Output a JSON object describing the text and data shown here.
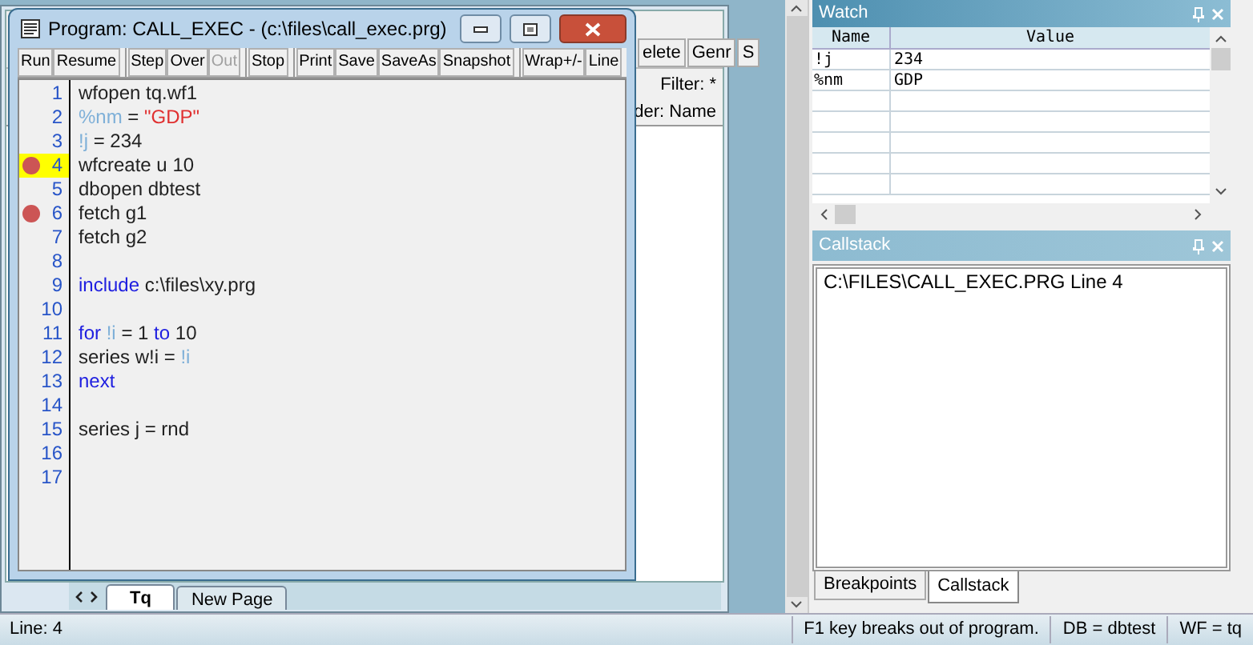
{
  "workfile": {
    "toolbar": [
      "elete",
      "Genr",
      "S"
    ],
    "filter": "Filter: *",
    "order": "der: Name",
    "tabs": [
      {
        "label": "Tq",
        "selected": true
      },
      {
        "label": "New Page",
        "selected": false
      }
    ]
  },
  "program_window": {
    "title": "Program: CALL_EXEC - (c:\\files\\call_exec.prg)",
    "toolbar_groups": [
      [
        {
          "label": "Run",
          "disabled": false
        },
        {
          "label": "Resume",
          "disabled": false
        }
      ],
      [
        {
          "label": "Step",
          "disabled": false
        },
        {
          "label": "Over",
          "disabled": false
        },
        {
          "label": "Out",
          "disabled": true
        }
      ],
      [
        {
          "label": "Stop",
          "disabled": false
        }
      ],
      [
        {
          "label": "Print",
          "disabled": false
        },
        {
          "label": "Save",
          "disabled": false
        },
        {
          "label": "SaveAs",
          "disabled": false
        },
        {
          "label": "Snapshot",
          "disabled": false
        }
      ],
      [
        {
          "label": "Wrap+/-",
          "disabled": false
        },
        {
          "label": "Line",
          "disabled": false
        }
      ]
    ],
    "lines": [
      {
        "number": "1",
        "breakpoint": false,
        "current": false,
        "tokens": [
          {
            "kind": "plain",
            "text": "wfopen tq.wf1"
          }
        ]
      },
      {
        "number": "2",
        "breakpoint": false,
        "current": false,
        "tokens": [
          {
            "kind": "variable",
            "text": "%nm"
          },
          {
            "kind": "plain",
            "text": " = "
          },
          {
            "kind": "string",
            "text": "\"GDP\""
          }
        ]
      },
      {
        "number": "3",
        "breakpoint": false,
        "current": false,
        "tokens": [
          {
            "kind": "variable",
            "text": "!j"
          },
          {
            "kind": "plain",
            "text": " = 234"
          }
        ]
      },
      {
        "number": "4",
        "breakpoint": true,
        "current": true,
        "tokens": [
          {
            "kind": "plain",
            "text": "wfcreate u 10"
          }
        ]
      },
      {
        "number": "5",
        "breakpoint": false,
        "current": false,
        "tokens": [
          {
            "kind": "plain",
            "text": "dbopen dbtest"
          }
        ]
      },
      {
        "number": "6",
        "breakpoint": true,
        "current": false,
        "tokens": [
          {
            "kind": "plain",
            "text": "fetch g1"
          }
        ]
      },
      {
        "number": "7",
        "breakpoint": false,
        "current": false,
        "tokens": [
          {
            "kind": "plain",
            "text": "fetch g2"
          }
        ]
      },
      {
        "number": "8",
        "breakpoint": false,
        "current": false
      },
      {
        "number": "9",
        "breakpoint": false,
        "current": false,
        "tokens": [
          {
            "kind": "keyword",
            "text": "include"
          },
          {
            "kind": "plain",
            "text": " c:\\files\\xy.prg"
          }
        ]
      },
      {
        "number": "10",
        "breakpoint": false,
        "current": false
      },
      {
        "number": "11",
        "breakpoint": false,
        "current": false,
        "tokens": [
          {
            "kind": "keyword",
            "text": "for"
          },
          {
            "kind": "variable",
            "text": " !i"
          },
          {
            "kind": "plain",
            "text": " = 1 "
          },
          {
            "kind": "keyword",
            "text": "to"
          },
          {
            "kind": "plain",
            "text": " 10"
          }
        ]
      },
      {
        "number": "12",
        "breakpoint": false,
        "current": false,
        "tokens": [
          {
            "kind": "plain",
            "text": "series w!i = "
          },
          {
            "kind": "variable",
            "text": "!i"
          }
        ]
      },
      {
        "number": "13",
        "breakpoint": false,
        "current": false,
        "tokens": [
          {
            "kind": "keyword",
            "text": "next"
          }
        ]
      },
      {
        "number": "14",
        "breakpoint": false,
        "current": false
      },
      {
        "number": "15",
        "breakpoint": false,
        "current": false,
        "tokens": [
          {
            "kind": "plain",
            "text": "series j = rnd"
          }
        ]
      },
      {
        "number": "16",
        "breakpoint": false,
        "current": false
      },
      {
        "number": "17",
        "breakpoint": false,
        "current": false
      }
    ]
  },
  "watch": {
    "title": "Watch",
    "columns": [
      "Name",
      "Value"
    ],
    "rows": [
      {
        "name": "!j",
        "value": "234"
      },
      {
        "name": "%nm",
        "value": "GDP"
      }
    ]
  },
  "callstack": {
    "title": "Callstack",
    "entries": [
      "C:\\FILES\\CALL_EXEC.PRG Line 4"
    ]
  },
  "panel_tabs": [
    {
      "label": "Breakpoints",
      "selected": false
    },
    {
      "label": "Callstack",
      "selected": true
    }
  ],
  "status_bar": [
    "Line: 4",
    "F1 key breaks out of program.",
    "DB = dbtest",
    "WF = tq"
  ]
}
